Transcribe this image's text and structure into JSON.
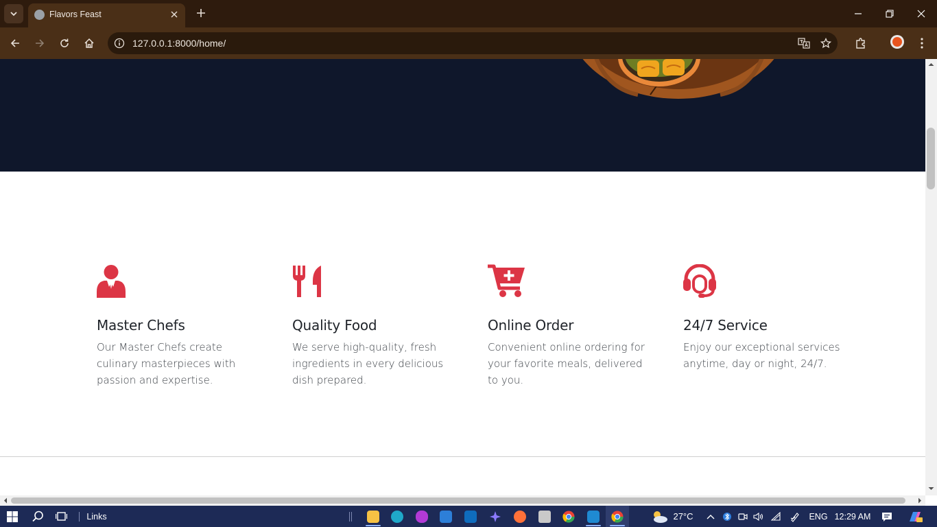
{
  "browser": {
    "tab_title": "Flavors Feast",
    "url": "127.0.0.1:8000/home/"
  },
  "features": [
    {
      "title": "Master Chefs",
      "text": "Our Master Chefs create culinary masterpieces with passion and expertise.",
      "icon": "chef-icon"
    },
    {
      "title": "Quality Food",
      "text": "We serve high-quality, fresh ingredients in every delicious dish prepared.",
      "icon": "utensils-icon"
    },
    {
      "title": "Online Order",
      "text": "Convenient online ordering for your favorite meals, delivered to you.",
      "icon": "cart-plus-icon"
    },
    {
      "title": "24/7 Service",
      "text": "Enjoy our exceptional services anytime, day or night, 24/7.",
      "icon": "headset-icon"
    }
  ],
  "taskbar": {
    "links_label": "Links",
    "temperature": "27°C",
    "language": "ENG",
    "time": "12:29 AM"
  },
  "colors": {
    "accent": "#dc3545",
    "hero_bg": "#0f172b",
    "browser_frame": "#2e1b0d",
    "browser_toolbar": "#4a2f17",
    "taskbar": "#1d2a56"
  }
}
